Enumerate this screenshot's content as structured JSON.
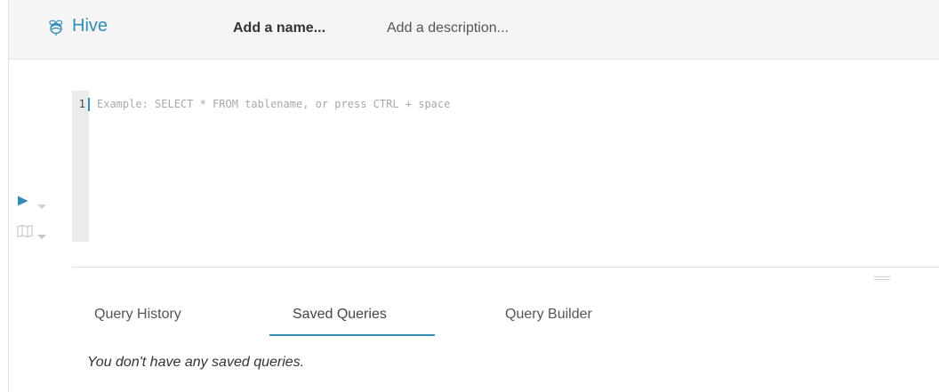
{
  "app": {
    "title": "Hive",
    "logo_icon": "hive-bee-icon",
    "accent_color": "#338bb8"
  },
  "header": {
    "name_placeholder": "Add a name...",
    "description_placeholder": "Add a description..."
  },
  "editor": {
    "line_numbers": [
      "1"
    ],
    "placeholder": "Example: SELECT * FROM tablename, or press CTRL + space"
  },
  "controls": {
    "run_icon": "play-icon",
    "explain_icon": "map-icon",
    "dropdown_icon": "caret-down-icon"
  },
  "tabs": [
    {
      "label": "Query History",
      "active": false
    },
    {
      "label": "Saved Queries",
      "active": true
    },
    {
      "label": "Query Builder",
      "active": false
    }
  ],
  "saved_queries": {
    "empty_message": "You don't have any saved queries."
  }
}
